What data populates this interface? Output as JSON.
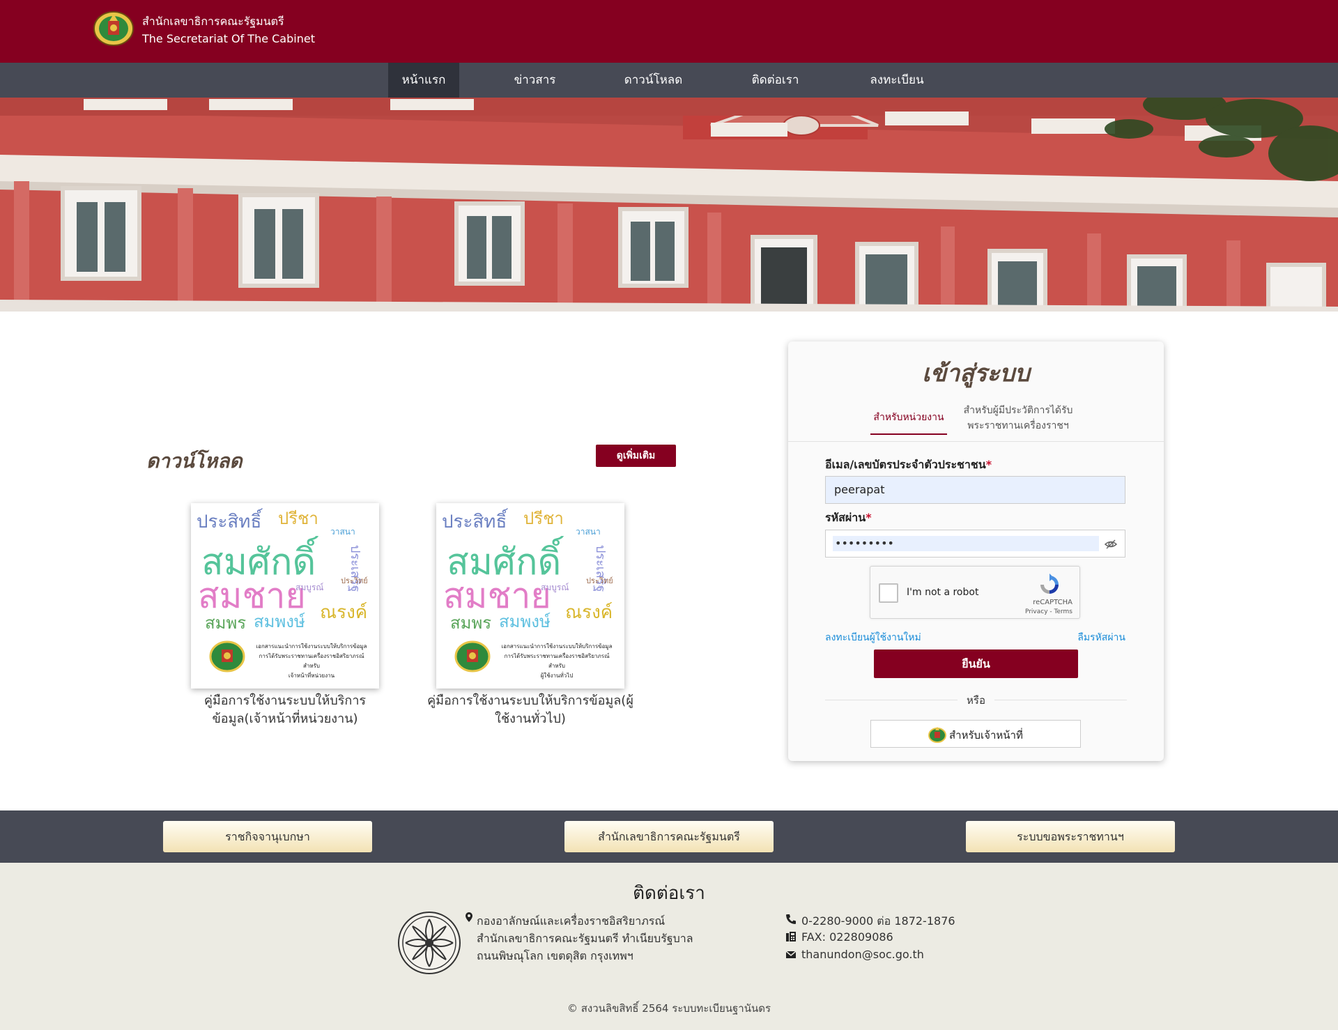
{
  "header": {
    "brand_th": "สำนักเลขาธิการคณะรัฐมนตรี",
    "brand_en": "The Secretariat Of The Cabinet"
  },
  "nav": {
    "items": [
      {
        "label": "หน้าแรก"
      },
      {
        "label": "ข่าวสาร"
      },
      {
        "label": "ดาวน์โหลด"
      },
      {
        "label": "ติดต่อเรา"
      },
      {
        "label": "ลงทะเบียน"
      }
    ],
    "active_index": 0
  },
  "downloads": {
    "title": "ดาวน์โหลด",
    "more_label": "ดูเพิ่มเติม",
    "items": [
      {
        "caption": "คู่มือการใช้งานระบบให้บริการข้อมูล(เจ้าหน้าที่หน่วยงาน)",
        "cover_lines": [
          "เอกสารแนะนำการใช้งานระบบให้บริการข้อมูล",
          "การได้รับพระราชทานเครื่องราชอิสริยาภรณ์",
          "สำหรับ",
          "เจ้าหน้าที่หน่วยงาน"
        ]
      },
      {
        "caption": "คู่มือการใช้งานระบบให้บริการข้อมูล(ผู้ใช้งานทั่วไป)",
        "cover_lines": [
          "เอกสารแนะนำการใช้งานระบบให้บริการข้อมูล",
          "การได้รับพระราชทานเครื่องราชอิสริยาภรณ์",
          "สำหรับ",
          "ผู้ใช้งานทั่วไป"
        ]
      }
    ],
    "wordcloud": {
      "big1": "สมศักดิ์",
      "big2": "สมชาย",
      "w1": "ประสิทธิ์",
      "w2": "ปรีชา",
      "w3": "สมพร",
      "w4": "สมพงษ์",
      "w5": "ณรงค์",
      "w6": "ประเสริฐ",
      "w7": "วาสนา",
      "w8": "สมบูรณ์",
      "w9": "ประวิทย์"
    }
  },
  "login": {
    "title": "เข้าสู่ระบบ",
    "tab_org": "สำหรับหน่วยงาน",
    "tab_recipient": "สำหรับผู้มีประวัติการได้รับพระราชทานเครื่องราชฯ",
    "email_label": "อีเมล/เลขบัตรประจำตัวประชาชน",
    "email_value": "peerapat",
    "password_label": "รหัสผ่าน",
    "password_value": "•••••••••",
    "required_mark": "*",
    "captcha_text": "I'm not a robot",
    "captcha_brand": "reCAPTCHA",
    "captcha_links": "Privacy - Terms",
    "register_link": "ลงทะเบียนผู้ใช้งานใหม่",
    "forgot_link": "ลืมรหัสผ่าน",
    "submit_label": "ยืนยัน",
    "or_label": "หรือ",
    "officer_label": "สำหรับเจ้าหน้าที่"
  },
  "quicklinks": [
    {
      "label": "ราชกิจจานุเบกษา"
    },
    {
      "label": "สำนักเลขาธิการคณะรัฐมนตรี"
    },
    {
      "label": "ระบบขอพระราชทานฯ"
    }
  ],
  "footer": {
    "title": "ติดต่อเรา",
    "address": [
      "กองอาลักษณ์และเครื่องราชอิสริยาภรณ์",
      "สำนักเลขาธิการคณะรัฐมนตรี ทำเนียบรัฐบาล",
      "ถนนพิษณุโลก เขตดุสิต กรุงเทพฯ"
    ],
    "phone": "0-2280-9000 ต่อ 1872-1876",
    "fax": "FAX: 022809086",
    "email": "thanundon@soc.go.th",
    "copyright": "© สงวนลิขสิทธิ์ 2564 ระบบทะเบียนฐานันดร"
  },
  "colors": {
    "brand": "#850020",
    "nav_bg": "#474a55",
    "footer_bg": "#ecebe3",
    "link": "#1a8cd8"
  }
}
